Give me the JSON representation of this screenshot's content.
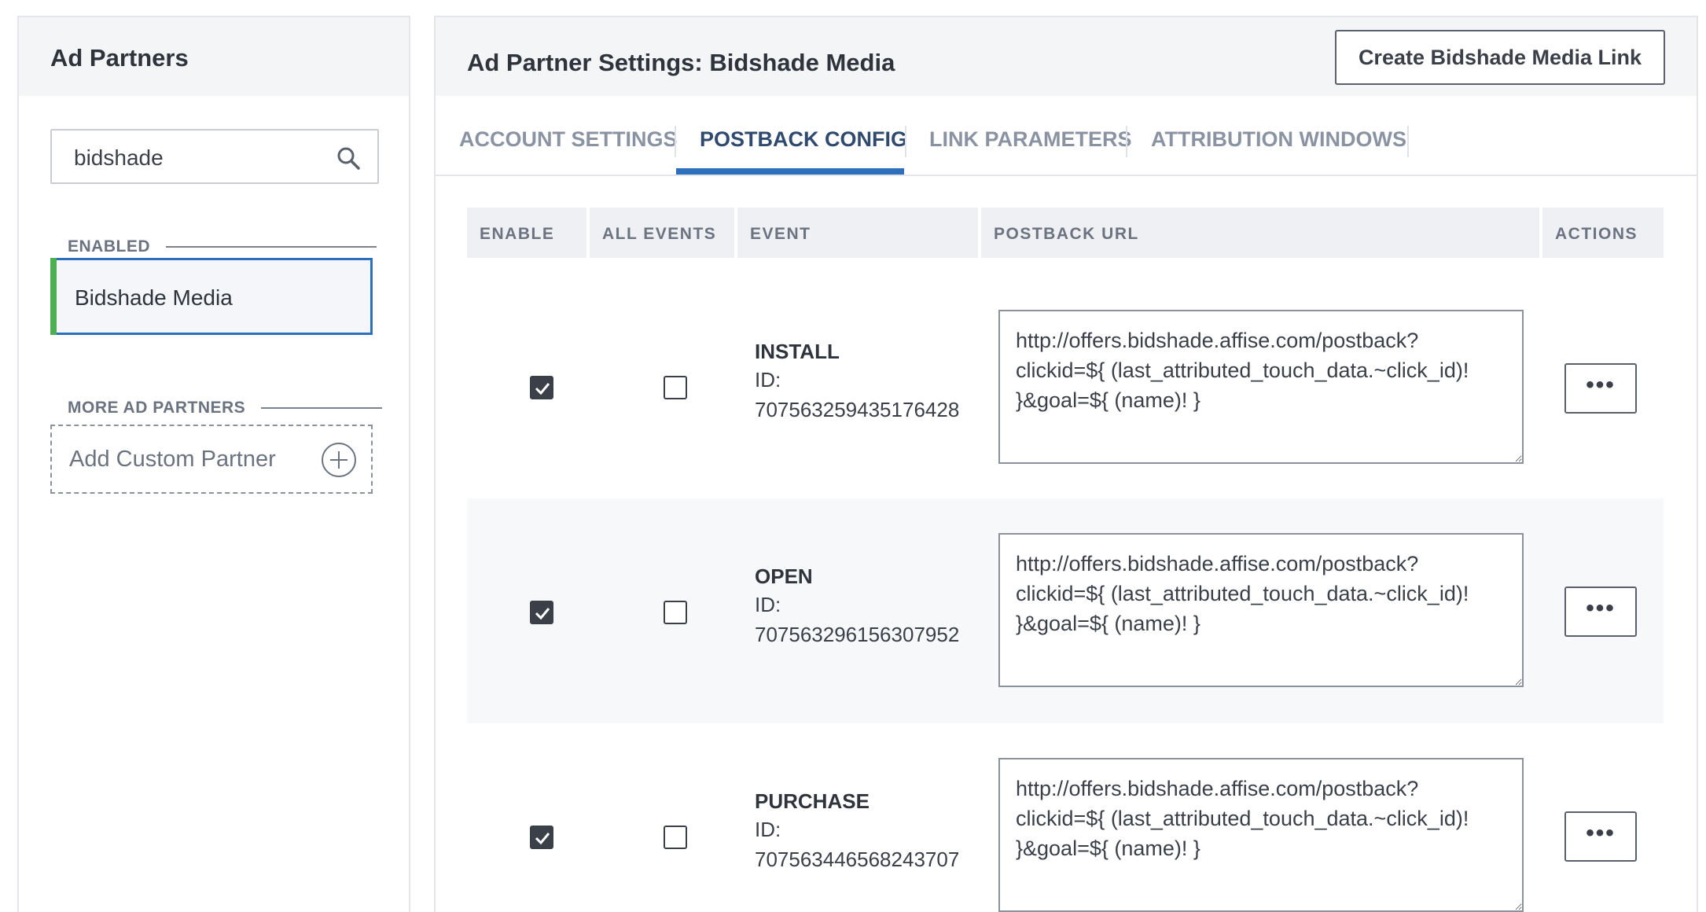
{
  "sidebar": {
    "title": "Ad Partners",
    "search": {
      "value": "bidshade",
      "placeholder": ""
    },
    "enabled_label": "ENABLED",
    "enabled_items": [
      {
        "label": "Bidshade Media"
      }
    ],
    "more_label": "MORE AD PARTNERS",
    "add_custom_label": "Add Custom Partner"
  },
  "main": {
    "title": "Ad Partner Settings: Bidshade Media",
    "create_link_label": "Create Bidshade Media Link",
    "tabs": [
      {
        "label": "ACCOUNT SETTINGS",
        "active": false
      },
      {
        "label": "POSTBACK CONFIG",
        "active": true
      },
      {
        "label": "LINK PARAMETERS",
        "active": false
      },
      {
        "label": "ATTRIBUTION WINDOWS",
        "active": false
      }
    ],
    "table": {
      "headers": [
        "ENABLE",
        "ALL EVENTS",
        "EVENT",
        "POSTBACK URL",
        "ACTIONS"
      ],
      "rows": [
        {
          "enabled": true,
          "all_events": false,
          "event": "INSTALL",
          "id_label": "ID:",
          "id": "707563259435176428",
          "postback_url": "http://offers.bidshade.affise.com/postback?clickid=${ (last_attributed_touch_data.~click_id)! }&goal=${ (name)! }",
          "actions_label": "•••"
        },
        {
          "enabled": true,
          "all_events": false,
          "event": "OPEN",
          "id_label": "ID:",
          "id": "707563296156307952",
          "postback_url": "http://offers.bidshade.affise.com/postback?clickid=${ (last_attributed_touch_data.~click_id)! }&goal=${ (name)! }",
          "actions_label": "•••"
        },
        {
          "enabled": true,
          "all_events": false,
          "event": "PURCHASE",
          "id_label": "ID:",
          "id": "707563446568243707",
          "postback_url": "http://offers.bidshade.affise.com/postback?clickid=${ (last_attributed_touch_data.~click_id)! }&goal=${ (name)! }",
          "actions_label": "•••"
        }
      ]
    }
  },
  "colors": {
    "accent_blue": "#2d6fbd",
    "enabled_green": "#4cb052",
    "header_bg": "#f4f5f7"
  }
}
